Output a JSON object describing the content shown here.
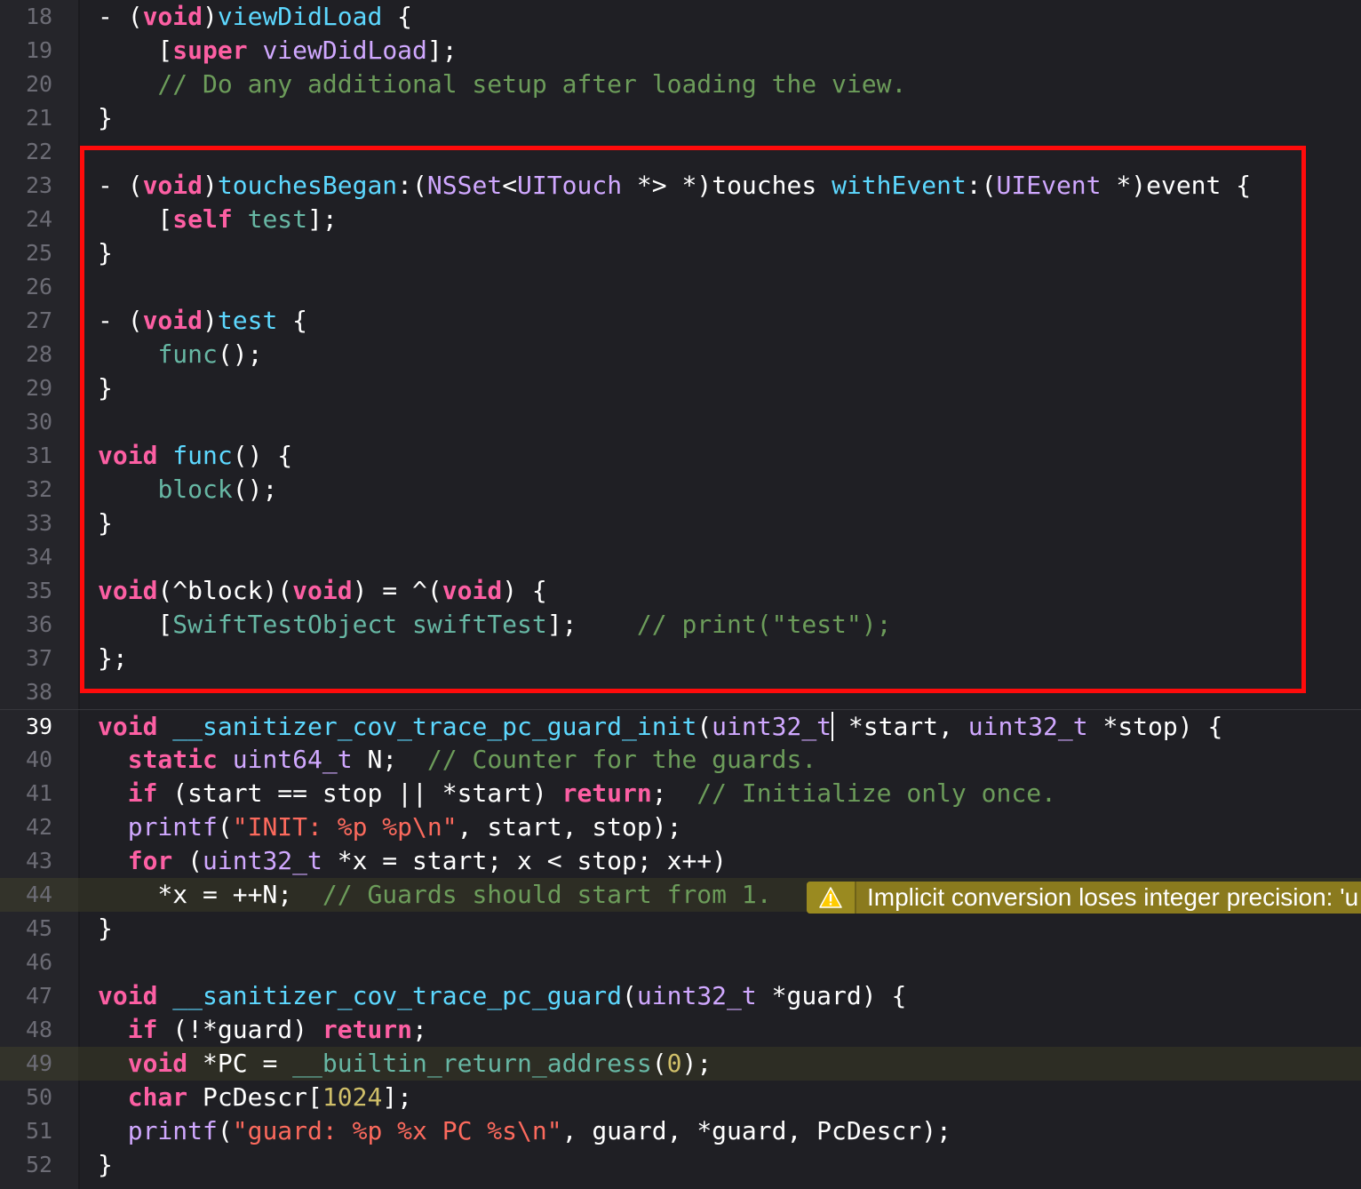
{
  "editor": {
    "current_line": "39",
    "lines": [
      {
        "n": "18",
        "tokens": [
          {
            "c": "pl",
            "t": "- ("
          },
          {
            "c": "kw",
            "t": "void"
          },
          {
            "c": "pl",
            "t": ")"
          },
          {
            "c": "fd",
            "t": "viewDidLoad"
          },
          {
            "c": "pl",
            "t": " {"
          }
        ]
      },
      {
        "n": "19",
        "tokens": [
          {
            "c": "pl",
            "t": "    ["
          },
          {
            "c": "kw",
            "t": "super"
          },
          {
            "c": "pl",
            "t": " "
          },
          {
            "c": "cls",
            "t": "viewDidLoad"
          },
          {
            "c": "pl",
            "t": "];"
          }
        ]
      },
      {
        "n": "20",
        "tokens": [
          {
            "c": "cm",
            "t": "    // Do any additional setup after loading the view."
          }
        ]
      },
      {
        "n": "21",
        "tokens": [
          {
            "c": "pl",
            "t": "}"
          }
        ]
      },
      {
        "n": "22",
        "tokens": []
      },
      {
        "n": "23",
        "tokens": [
          {
            "c": "pl",
            "t": "- ("
          },
          {
            "c": "kw",
            "t": "void"
          },
          {
            "c": "pl",
            "t": ")"
          },
          {
            "c": "fd",
            "t": "touchesBegan"
          },
          {
            "c": "pl",
            "t": ":("
          },
          {
            "c": "cls",
            "t": "NSSet"
          },
          {
            "c": "pl",
            "t": "<"
          },
          {
            "c": "cls",
            "t": "UITouch"
          },
          {
            "c": "pl",
            "t": " *> *)touches "
          },
          {
            "c": "fd",
            "t": "withEvent"
          },
          {
            "c": "pl",
            "t": ":("
          },
          {
            "c": "cls",
            "t": "UIEvent"
          },
          {
            "c": "pl",
            "t": " *)event {"
          }
        ]
      },
      {
        "n": "24",
        "tokens": [
          {
            "c": "pl",
            "t": "    ["
          },
          {
            "c": "kw",
            "t": "self"
          },
          {
            "c": "pl",
            "t": " "
          },
          {
            "c": "fn",
            "t": "test"
          },
          {
            "c": "pl",
            "t": "];"
          }
        ]
      },
      {
        "n": "25",
        "tokens": [
          {
            "c": "pl",
            "t": "}"
          }
        ]
      },
      {
        "n": "26",
        "tokens": []
      },
      {
        "n": "27",
        "tokens": [
          {
            "c": "pl",
            "t": "- ("
          },
          {
            "c": "kw",
            "t": "void"
          },
          {
            "c": "pl",
            "t": ")"
          },
          {
            "c": "fd",
            "t": "test"
          },
          {
            "c": "pl",
            "t": " {"
          }
        ]
      },
      {
        "n": "28",
        "tokens": [
          {
            "c": "pl",
            "t": "    "
          },
          {
            "c": "fn",
            "t": "func"
          },
          {
            "c": "pl",
            "t": "();"
          }
        ]
      },
      {
        "n": "29",
        "tokens": [
          {
            "c": "pl",
            "t": "}"
          }
        ]
      },
      {
        "n": "30",
        "tokens": []
      },
      {
        "n": "31",
        "tokens": [
          {
            "c": "kw",
            "t": "void"
          },
          {
            "c": "pl",
            "t": " "
          },
          {
            "c": "fd",
            "t": "func"
          },
          {
            "c": "pl",
            "t": "() {"
          }
        ]
      },
      {
        "n": "32",
        "tokens": [
          {
            "c": "pl",
            "t": "    "
          },
          {
            "c": "fn",
            "t": "block"
          },
          {
            "c": "pl",
            "t": "();"
          }
        ]
      },
      {
        "n": "33",
        "tokens": [
          {
            "c": "pl",
            "t": "}"
          }
        ]
      },
      {
        "n": "34",
        "tokens": []
      },
      {
        "n": "35",
        "tokens": [
          {
            "c": "kw",
            "t": "void"
          },
          {
            "c": "pl",
            "t": "(^block)("
          },
          {
            "c": "kw",
            "t": "void"
          },
          {
            "c": "pl",
            "t": ") = ^("
          },
          {
            "c": "kw",
            "t": "void"
          },
          {
            "c": "pl",
            "t": ") {"
          }
        ]
      },
      {
        "n": "36",
        "tokens": [
          {
            "c": "pl",
            "t": "    ["
          },
          {
            "c": "fn",
            "t": "SwiftTestObject"
          },
          {
            "c": "pl",
            "t": " "
          },
          {
            "c": "fn",
            "t": "swiftTest"
          },
          {
            "c": "pl",
            "t": "];    "
          },
          {
            "c": "cm",
            "t": "// print(\"test\");"
          }
        ]
      },
      {
        "n": "37",
        "tokens": [
          {
            "c": "pl",
            "t": "};"
          }
        ]
      },
      {
        "n": "38",
        "tokens": []
      },
      {
        "n": "39",
        "tokens": [
          {
            "c": "kw",
            "t": "void"
          },
          {
            "c": "pl",
            "t": " "
          },
          {
            "c": "fd",
            "t": "__sanitizer_cov_trace_pc_guard_init"
          },
          {
            "c": "pl",
            "t": "("
          },
          {
            "c": "cls",
            "t": "uint32_t"
          },
          {
            "c": "caret",
            "t": ""
          },
          {
            "c": "pl",
            "t": " *start, "
          },
          {
            "c": "cls",
            "t": "uint32_t"
          },
          {
            "c": "pl",
            "t": " *stop) {"
          }
        ]
      },
      {
        "n": "40",
        "tokens": [
          {
            "c": "pl",
            "t": "  "
          },
          {
            "c": "kw",
            "t": "static"
          },
          {
            "c": "pl",
            "t": " "
          },
          {
            "c": "cls",
            "t": "uint64_t"
          },
          {
            "c": "pl",
            "t": " N;  "
          },
          {
            "c": "cm",
            "t": "// Counter for the guards."
          }
        ]
      },
      {
        "n": "41",
        "tokens": [
          {
            "c": "pl",
            "t": "  "
          },
          {
            "c": "kw",
            "t": "if"
          },
          {
            "c": "pl",
            "t": " (start == stop || *start) "
          },
          {
            "c": "kw",
            "t": "return"
          },
          {
            "c": "pl",
            "t": ";  "
          },
          {
            "c": "cm",
            "t": "// Initialize only once."
          }
        ]
      },
      {
        "n": "42",
        "tokens": [
          {
            "c": "pl",
            "t": "  "
          },
          {
            "c": "cls",
            "t": "printf"
          },
          {
            "c": "pl",
            "t": "("
          },
          {
            "c": "str",
            "t": "\"INIT: %p %p\\n\""
          },
          {
            "c": "pl",
            "t": ", start, stop);"
          }
        ]
      },
      {
        "n": "43",
        "tokens": [
          {
            "c": "pl",
            "t": "  "
          },
          {
            "c": "kw",
            "t": "for"
          },
          {
            "c": "pl",
            "t": " ("
          },
          {
            "c": "cls",
            "t": "uint32_t"
          },
          {
            "c": "pl",
            "t": " *x = start; x < stop; x++)"
          }
        ]
      },
      {
        "n": "44",
        "tokens": [
          {
            "c": "pl",
            "t": "    *x = ++N;  "
          },
          {
            "c": "cm",
            "t": "// Guards should start from 1."
          }
        ]
      },
      {
        "n": "45",
        "tokens": [
          {
            "c": "pl",
            "t": "}"
          }
        ]
      },
      {
        "n": "46",
        "tokens": []
      },
      {
        "n": "47",
        "tokens": [
          {
            "c": "kw",
            "t": "void"
          },
          {
            "c": "pl",
            "t": " "
          },
          {
            "c": "fd",
            "t": "__sanitizer_cov_trace_pc_guard"
          },
          {
            "c": "pl",
            "t": "("
          },
          {
            "c": "cls",
            "t": "uint32_t"
          },
          {
            "c": "pl",
            "t": " *guard) {"
          }
        ]
      },
      {
        "n": "48",
        "tokens": [
          {
            "c": "pl",
            "t": "  "
          },
          {
            "c": "kw",
            "t": "if"
          },
          {
            "c": "pl",
            "t": " (!*guard) "
          },
          {
            "c": "kw",
            "t": "return"
          },
          {
            "c": "pl",
            "t": ";"
          }
        ]
      },
      {
        "n": "49",
        "tokens": [
          {
            "c": "pl",
            "t": "  "
          },
          {
            "c": "kw",
            "t": "void"
          },
          {
            "c": "pl",
            "t": " *PC = "
          },
          {
            "c": "fn",
            "t": "__builtin_return_address"
          },
          {
            "c": "pl",
            "t": "("
          },
          {
            "c": "num",
            "t": "0"
          },
          {
            "c": "pl",
            "t": ");"
          }
        ]
      },
      {
        "n": "50",
        "tokens": [
          {
            "c": "pl",
            "t": "  "
          },
          {
            "c": "kw",
            "t": "char"
          },
          {
            "c": "pl",
            "t": " PcDescr["
          },
          {
            "c": "num",
            "t": "1024"
          },
          {
            "c": "pl",
            "t": "];"
          }
        ]
      },
      {
        "n": "51",
        "tokens": [
          {
            "c": "pl",
            "t": "  "
          },
          {
            "c": "cls",
            "t": "printf"
          },
          {
            "c": "pl",
            "t": "("
          },
          {
            "c": "str",
            "t": "\"guard: %p %x PC %s\\n\""
          },
          {
            "c": "pl",
            "t": ", guard, *guard, PcDescr);"
          }
        ]
      },
      {
        "n": "52",
        "tokens": [
          {
            "c": "pl",
            "t": "}"
          }
        ]
      }
    ]
  },
  "highlighted_lines": [
    "44",
    "49"
  ],
  "warning": {
    "line": "44",
    "icon": "warning-triangle-icon",
    "text": "Implicit conversion loses integer precision: 'u"
  },
  "colors": {
    "background": "#1f1f24",
    "keyword": "#fc5fa3",
    "comment": "#6c9c5a",
    "string": "#fc6a5d",
    "type": "#d0a8ff",
    "declaration": "#5dd8ff",
    "function": "#67b7a4",
    "number": "#d0bf69",
    "highlight_box": "#ff0b0b",
    "warning": "#8a7a1e"
  }
}
